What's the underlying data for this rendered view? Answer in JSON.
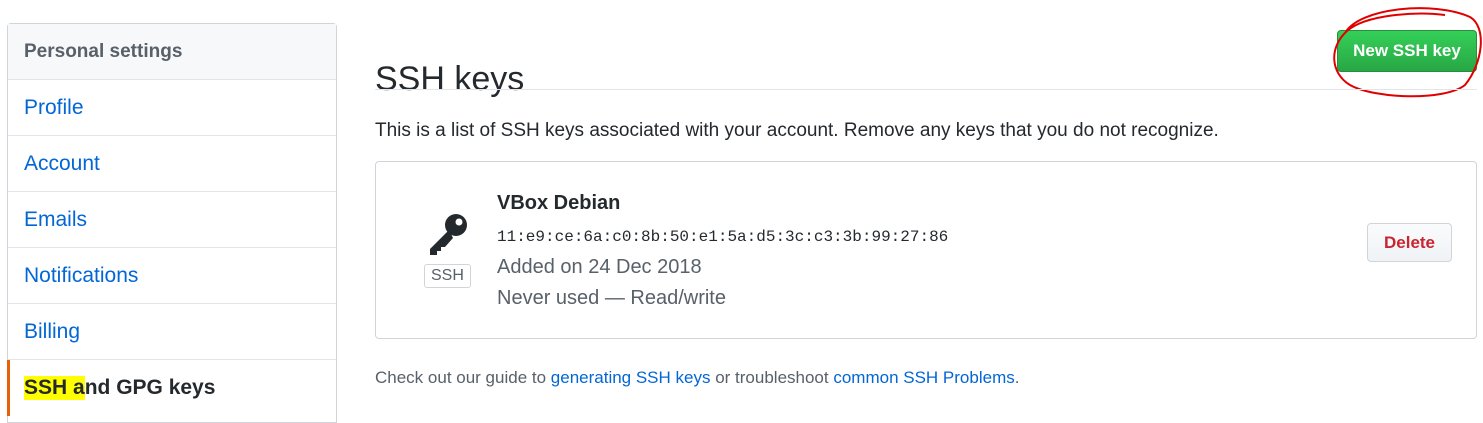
{
  "sidebar": {
    "header": "Personal settings",
    "items": [
      {
        "label": "Profile"
      },
      {
        "label": "Account"
      },
      {
        "label": "Emails"
      },
      {
        "label": "Notifications"
      },
      {
        "label": "Billing"
      }
    ],
    "selected": {
      "label_highlight": "SSH a",
      "label_rest": "nd GPG keys"
    }
  },
  "main": {
    "title": "SSH keys",
    "new_key_button": "New SSH key",
    "description": "This is a list of SSH keys associated with your account. Remove any keys that you do not recognize.",
    "key": {
      "icon": "key-icon",
      "badge": "SSH",
      "title": "VBox Debian",
      "fingerprint": "11:e9:ce:6a:c0:8b:50:e1:5a:d5:3c:c3:3b:99:27:86",
      "added": "Added on 24 Dec 2018",
      "usage": "Never used — Read/write",
      "delete_button": "Delete"
    },
    "guide": {
      "prefix": "Check out our guide to ",
      "link1": "generating SSH keys",
      "middle": " or troubleshoot ",
      "link2": "common SSH Problems",
      "suffix": "."
    }
  },
  "colors": {
    "link": "#0366d6",
    "primary_button": "#28a745",
    "danger": "#cb2431",
    "selected_marker": "#e36209",
    "text_highlight": "#ffff00",
    "annotation": "#e00000"
  }
}
